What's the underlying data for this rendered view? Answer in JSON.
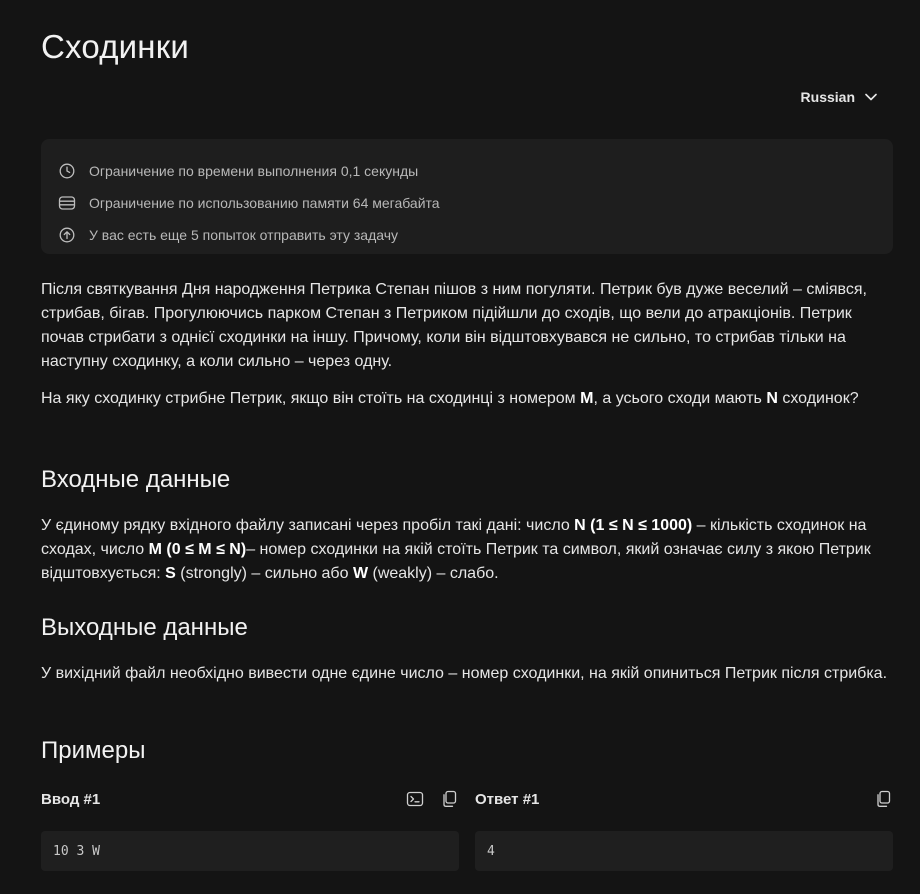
{
  "problem": {
    "title": "Сходинки",
    "language": "Russian"
  },
  "limits": [
    {
      "icon": "clock-icon",
      "text": "Ограничение по времени выполнения 0,1 секунды"
    },
    {
      "icon": "memory-icon",
      "text": "Ограничение по использованию памяти 64 мегабайта"
    },
    {
      "icon": "upload-icon",
      "text": "У вас есть еще 5 попыток отправить эту задачу"
    }
  ],
  "statement": {
    "p1": "Після святкування Дня народження Петрика Степан пішов з ним погуляти. Петрик був дуже веселий – сміявся, стрибав, бігав. Прогулюючись парком Степан з Петриком підійшли до сходів, що вели до атракціонів. Петрик почав стрибати з однієї сходинки на іншу. Причому, коли він відштовхувався не сильно, то стрибав тільки на наступну сходинку, а коли сильно – через одну.",
    "p2_a": "На яку сходинку стрибне Петрик, якщо він стоїть на сходинці з номером ",
    "p2_m": "M",
    "p2_b": ", а усього сходи мають ",
    "p2_n": "N",
    "p2_c": " сходинок?"
  },
  "input_section": {
    "heading": "Входные данные",
    "t1": "У єдиному рядку вхідного файлу записані через пробіл такі дані: число ",
    "b1": "N (1 ≤ N ≤ 1000)",
    "t2": " – кількість сходинок на сходах, число ",
    "b2": "M (0 ≤ M ≤ N)",
    "t3": "– номер сходинки на якій стоїть Петрик та символ, який означає силу з якою Петрик відштовхується: ",
    "b3": "S",
    "t4": " (strongly) – сильно або ",
    "b4": "W",
    "t5": " (weakly) – слабо."
  },
  "output_section": {
    "heading": "Выходные данные",
    "text": "У вихідний файл необхідно вивести одне єдине число – номер сходинки, на якій опиниться Петрик після стрибка."
  },
  "examples": {
    "heading": "Примеры",
    "input_label": "Ввод #1",
    "input_value": "10 3 W",
    "output_label": "Ответ #1",
    "output_value": "4"
  }
}
